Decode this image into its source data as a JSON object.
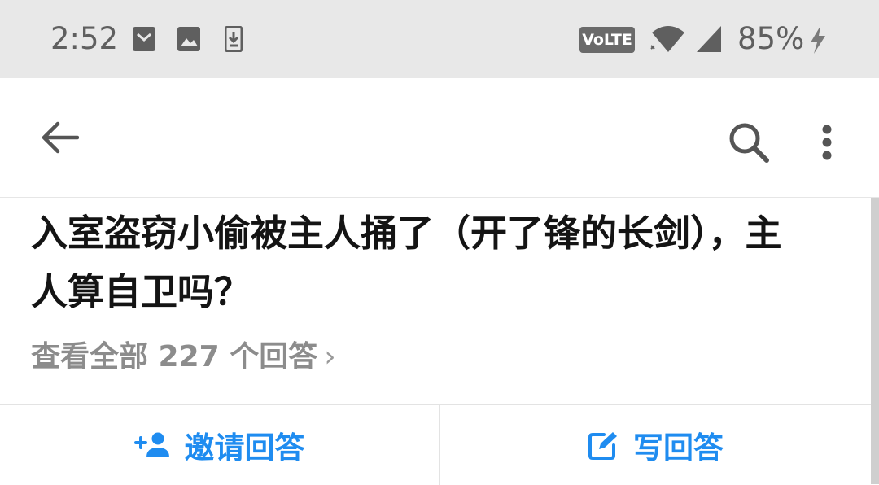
{
  "status_bar": {
    "time": "2:52",
    "icons": [
      "mail-icon",
      "image-icon",
      "download-icon"
    ],
    "network_badge": "VoLTE",
    "battery_percent": "85%",
    "status_icons": [
      "wifi-icon",
      "signal-icon",
      "charging-icon"
    ]
  },
  "toolbar": {
    "back_icon": "arrow-left-icon",
    "search_icon": "search-icon",
    "menu_icon": "more-vert-icon"
  },
  "question": {
    "title": "入室盗窃小偷被主人捅了（开了锋的长剑），主人算自卫吗？",
    "view_all": "查看全部 227 个回答",
    "view_all_chevron": "›"
  },
  "actions": {
    "invite": {
      "label": "邀请回答",
      "icon": "add-person-icon"
    },
    "write": {
      "label": "写回答",
      "icon": "edit-icon"
    }
  },
  "colors": {
    "accent": "#1f8cf0",
    "status_bar_bg": "#e8e8e8",
    "muted_text": "#8c8c8c"
  }
}
